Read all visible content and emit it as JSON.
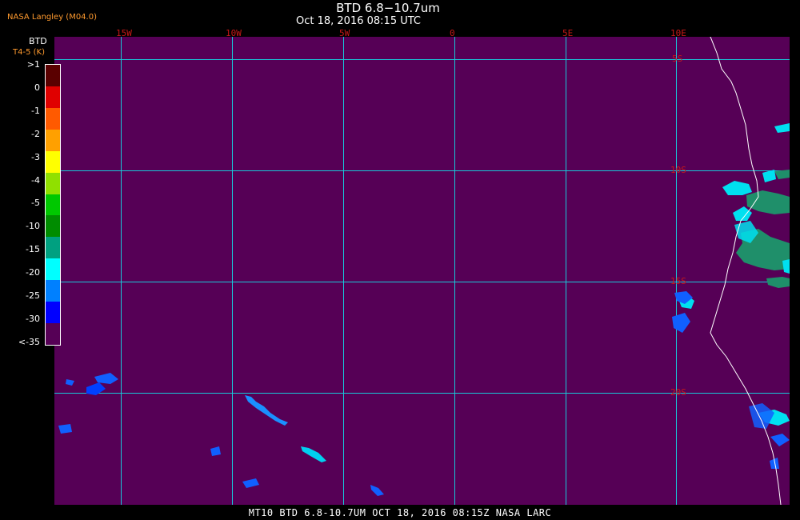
{
  "header": {
    "title": "BTD 6.8−10.7um",
    "subtitle": "Oct 18, 2016 08:15 UTC",
    "producer": "NASA Langley (M04.0)"
  },
  "legend": {
    "title": "BTD",
    "subtitle": "T4-5 (K)",
    "entries": [
      {
        "label": ">1",
        "color": "#5a0000"
      },
      {
        "label": "0",
        "color": "#e00000"
      },
      {
        "label": "-1",
        "color": "#ff5a00"
      },
      {
        "label": "-2",
        "color": "#ffa000"
      },
      {
        "label": "-3",
        "color": "#ffff00"
      },
      {
        "label": "-4",
        "color": "#90e000"
      },
      {
        "label": "-5",
        "color": "#00c800"
      },
      {
        "label": "-10",
        "color": "#008c00"
      },
      {
        "label": "-15",
        "color": "#00a080"
      },
      {
        "label": "-20",
        "color": "#00ffff"
      },
      {
        "label": "-25",
        "color": "#0080ff"
      },
      {
        "label": "-30",
        "color": "#0000ff"
      },
      {
        "label": "<-35",
        "color": "#560056"
      }
    ]
  },
  "grid": {
    "longitudes": [
      "15W",
      "10W",
      "5W",
      "0",
      "5E",
      "10E"
    ],
    "latitudes": [
      "5S",
      "10S",
      "15S",
      "20S"
    ]
  },
  "colors": {
    "background": "#560056",
    "grid": "#18c8d8",
    "grid_labels": "#c81818",
    "coastline": "#ffffff"
  },
  "footer": "MT10  BTD 6.8-10.7UM  OCT 18, 2016 08:15Z  NASA LARC"
}
